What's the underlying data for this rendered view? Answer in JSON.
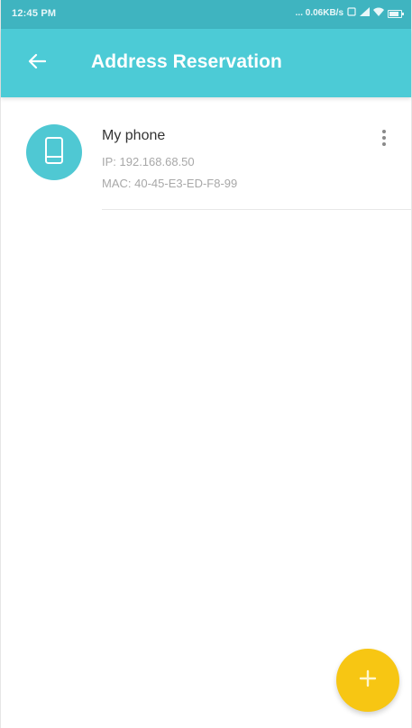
{
  "status_bar": {
    "time": "12:45 PM",
    "network_speed": "... 0.06KB/s"
  },
  "app_bar": {
    "title": "Address Reservation"
  },
  "reservations": [
    {
      "name": "My phone",
      "ip": "IP: 192.168.68.50",
      "mac": "MAC: 40-45-E3-ED-F8-99",
      "icon": "phone-icon"
    }
  ],
  "colors": {
    "status_bar": "#3fb4c0",
    "app_bar": "#4ccbd6",
    "avatar": "#4fc8d3",
    "fab": "#f7c613"
  },
  "icons": {
    "back": "arrow-left-icon",
    "more": "more-vertical-icon",
    "add": "plus-icon"
  }
}
